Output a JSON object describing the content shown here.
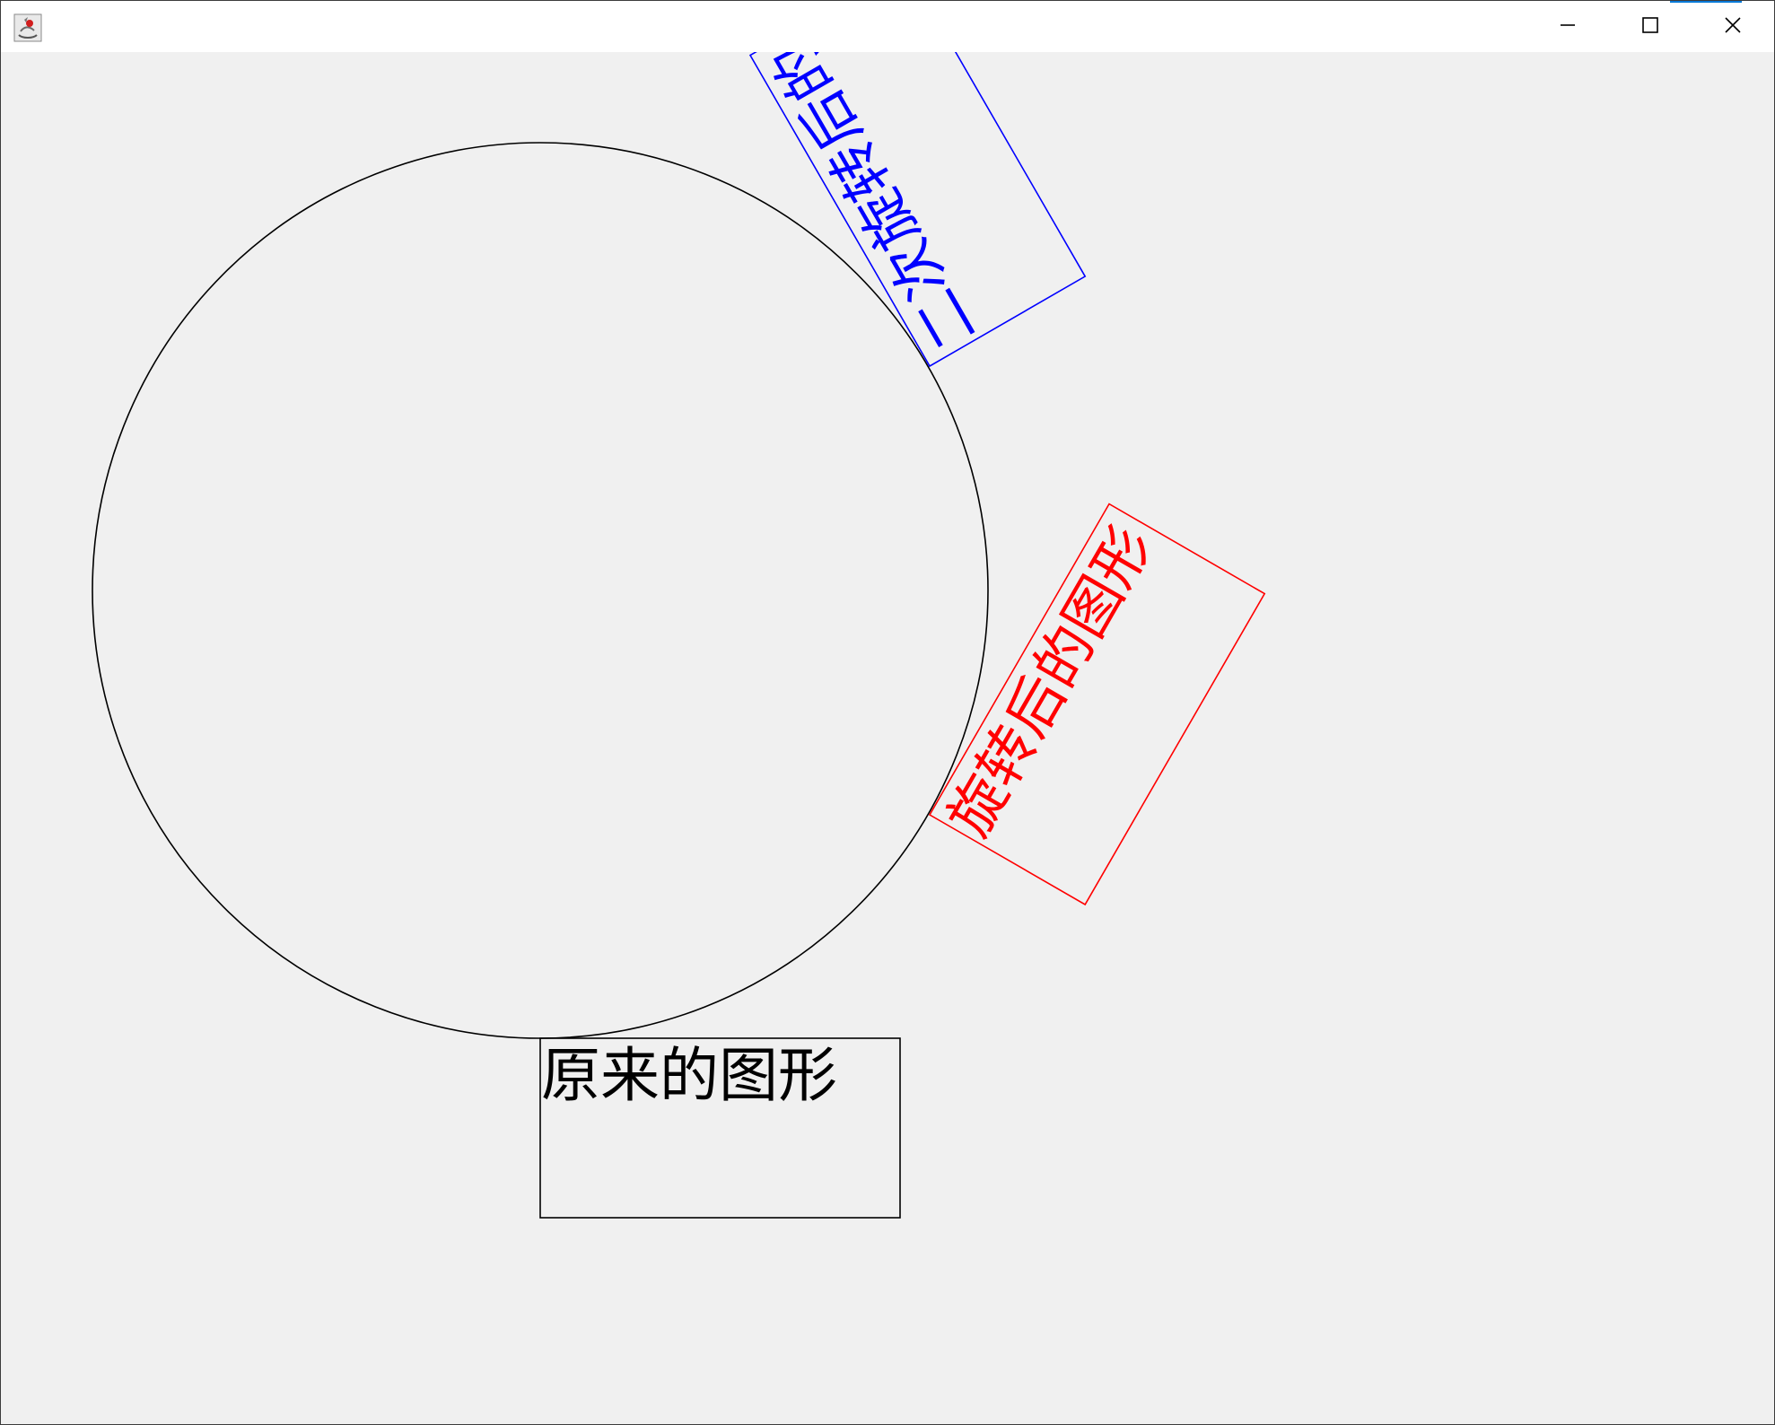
{
  "window": {
    "title": "",
    "icon": "java-app-icon",
    "controls": {
      "minimize": "minimize-icon",
      "maximize": "maximize-icon",
      "close": "close-icon"
    },
    "accent_color": "#0078d7"
  },
  "canvas": {
    "background_color": "#f0f0f0",
    "original_label": "原来的图形",
    "rotated_label": "旋转后的图形",
    "second_rotated_label": "二次旋转后的",
    "colors": {
      "original": "#000000",
      "rotated": "#ff0000",
      "second_rotated": "#0000ff"
    }
  }
}
